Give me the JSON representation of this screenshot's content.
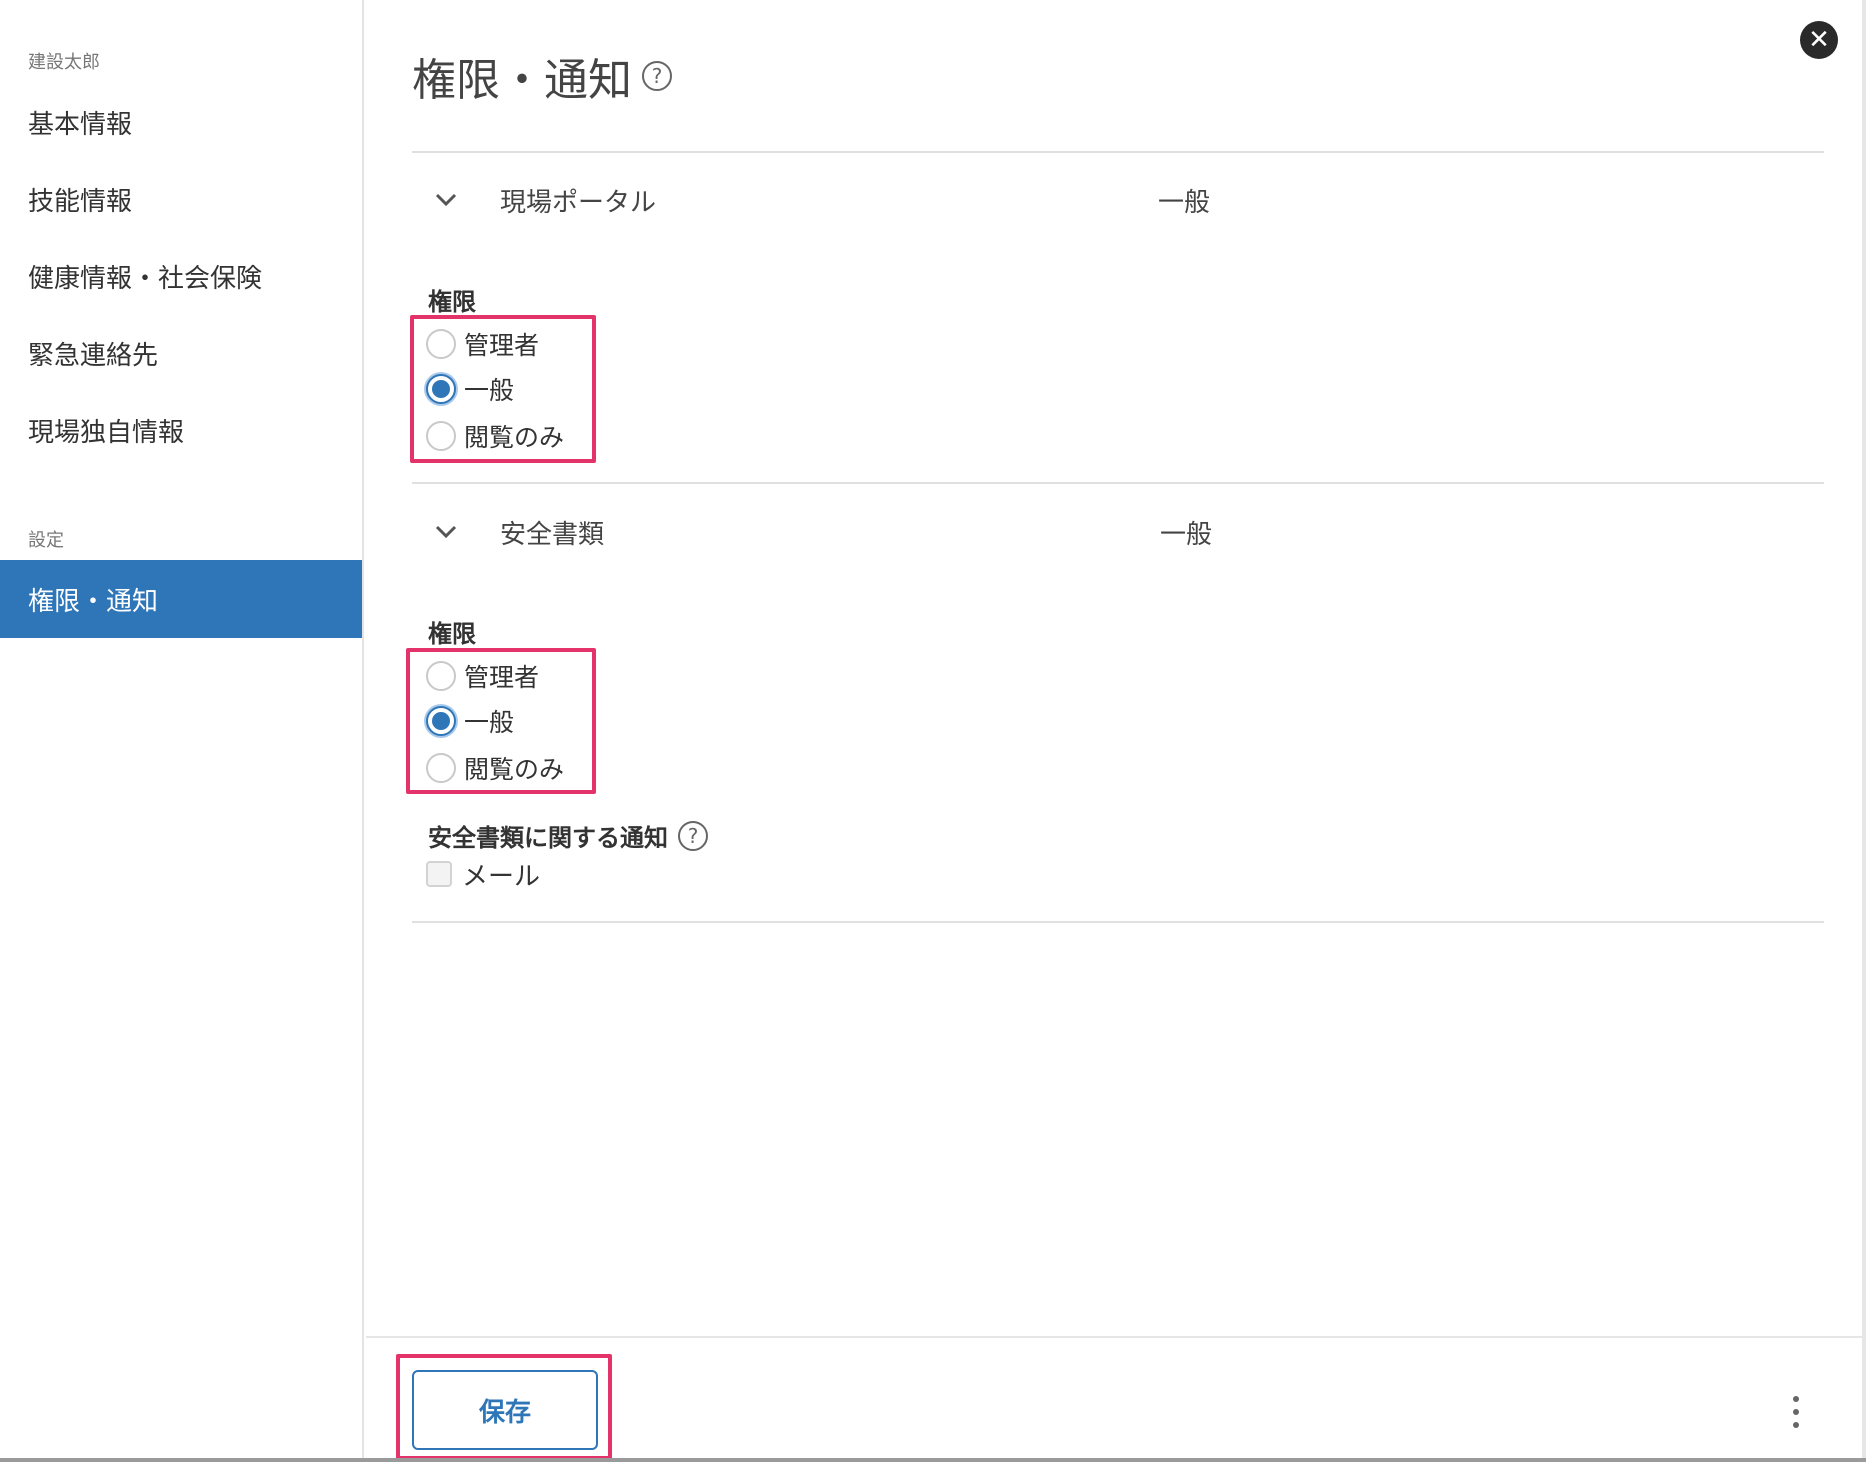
{
  "sidebar": {
    "user_name": "建設太郎",
    "items": [
      {
        "label": "基本情報"
      },
      {
        "label": "技能情報"
      },
      {
        "label": "健康情報・社会保険"
      },
      {
        "label": "緊急連絡先"
      },
      {
        "label": "現場独自情報"
      }
    ],
    "settings_section": "設定",
    "active_item": {
      "label": "権限・通知"
    }
  },
  "main": {
    "title": "権限・通知",
    "help_glyph": "?",
    "close_glyph": "✕",
    "sections": [
      {
        "name": "現場ポータル",
        "value": "一般",
        "permission_label": "権限",
        "options": [
          "管理者",
          "一般",
          "閲覧のみ"
        ],
        "selected": "一般"
      },
      {
        "name": "安全書類",
        "value": "一般",
        "permission_label": "権限",
        "options": [
          "管理者",
          "一般",
          "閲覧のみ"
        ],
        "selected": "一般",
        "notification_label": "安全書類に関する通知",
        "notification_options": [
          {
            "label": "メール",
            "checked": false
          }
        ]
      }
    ]
  },
  "footer": {
    "save_label": "保存"
  },
  "colors": {
    "accent": "#2f76b9",
    "highlight": "#e4336a",
    "close_bg": "#2a2a2a"
  }
}
